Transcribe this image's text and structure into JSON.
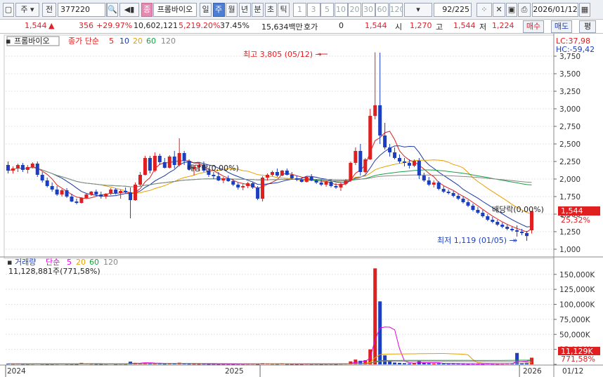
{
  "toolbar": {
    "market": "주",
    "prefix": "전",
    "code": "377220",
    "name_badge": "종",
    "name": "프롬바이오",
    "periods": [
      "일",
      "주",
      "월",
      "년",
      "분",
      "초",
      "틱"
    ],
    "active_period": "주",
    "intervals": [
      "1",
      "3",
      "5",
      "10",
      "20",
      "30",
      "60",
      "120"
    ],
    "count": "92",
    "total": "/225",
    "date": "2026/01/12"
  },
  "quote": {
    "price": "1,544",
    "change": "356",
    "change_pct": "+29.97%",
    "volume": "10,602,121",
    "volume_pct": "5,219.20%",
    "turnover_pct": "37.45%",
    "amount": "15,634백만",
    "hoga_label": "호가",
    "hoga": "0",
    "hoga_price": "1,544",
    "open_label": "시",
    "open": "1,270",
    "high_label": "고",
    "high": "1,544",
    "low_label": "저",
    "low": "1,224",
    "buy": "매수",
    "sell": "매도",
    "eval": "평"
  },
  "price_panel": {
    "legend_name": "프롬바이오",
    "legend_ma": "종가 단순",
    "ma_periods": [
      "5",
      "10",
      "20",
      "60",
      "120"
    ],
    "ma_colors": [
      "#e02020",
      "#1a3aa0",
      "#e8a000",
      "#18a040",
      "#888888"
    ],
    "lc": "LC:37,98",
    "hc": "HC:-59,42",
    "max_note": "최고 3,805 (05/12) →",
    "min_note": "최저 1,119 (01/05) →",
    "div_note1": "배당락(0,00%)",
    "div_note2": "배당락(0,00%)",
    "cur_price_tag": "1,544",
    "cur_pct_tag": "25,32%"
  },
  "volume_panel": {
    "legend_name": "거래량",
    "legend_ma": "단순",
    "ma_periods": [
      "5",
      "20",
      "60",
      "120"
    ],
    "ma_colors": [
      "#e000e0",
      "#e8a000",
      "#18a040",
      "#888888"
    ],
    "current": "11,128,881주(771,58%)",
    "cur_tag": "11,129K",
    "cur_pct_tag": "771,58%"
  },
  "x_axis": {
    "labels": [
      "2024",
      "2025",
      "2026"
    ],
    "date_label": "01/12"
  },
  "chart_data": {
    "type": "candlestick",
    "timeframe": "weekly",
    "price_axis": {
      "ticks": [
        1000,
        1250,
        1500,
        1750,
        2000,
        2250,
        2500,
        2750,
        3000,
        3250,
        3500,
        3750
      ],
      "ylim": [
        950,
        3850
      ]
    },
    "volume_axis": {
      "ticks": [
        0,
        25000,
        50000,
        75000,
        100000,
        125000,
        150000
      ],
      "tick_labels": [
        "0",
        "25,000K",
        "50,000K",
        "75,000K",
        "100,000K",
        "125,000K",
        "150,000K"
      ],
      "ylim": [
        0,
        165000
      ]
    },
    "candles": [
      [
        2200,
        2250,
        2080,
        2120
      ],
      [
        2120,
        2180,
        2080,
        2150
      ],
      [
        2150,
        2220,
        2100,
        2200
      ],
      [
        2200,
        2230,
        2100,
        2130
      ],
      [
        2130,
        2200,
        2080,
        2170
      ],
      [
        2170,
        2240,
        2150,
        2220
      ],
      [
        2220,
        2250,
        2030,
        2060
      ],
      [
        2060,
        2100,
        1950,
        1980
      ],
      [
        1980,
        2020,
        1880,
        1900
      ],
      [
        1900,
        1950,
        1820,
        1850
      ],
      [
        1850,
        1900,
        1760,
        1780
      ],
      [
        1780,
        1860,
        1750,
        1840
      ],
      [
        1840,
        1870,
        1730,
        1750
      ],
      [
        1750,
        1790,
        1670,
        1680
      ],
      [
        1680,
        1720,
        1640,
        1660
      ],
      [
        1660,
        1740,
        1650,
        1730
      ],
      [
        1730,
        1790,
        1720,
        1780
      ],
      [
        1780,
        1830,
        1760,
        1820
      ],
      [
        1820,
        1850,
        1760,
        1780
      ],
      [
        1780,
        1820,
        1720,
        1750
      ],
      [
        1750,
        1800,
        1720,
        1790
      ],
      [
        1790,
        1870,
        1770,
        1850
      ],
      [
        1850,
        1870,
        1780,
        1800
      ],
      [
        1800,
        1850,
        1720,
        1830
      ],
      [
        1830,
        1880,
        1800,
        1810
      ],
      [
        1810,
        1880,
        1440,
        1700
      ],
      [
        1700,
        1950,
        1690,
        1920
      ],
      [
        1920,
        2100,
        1900,
        2060
      ],
      [
        2060,
        2330,
        2050,
        2300
      ],
      [
        2300,
        2330,
        2080,
        2120
      ],
      [
        2120,
        2380,
        2100,
        2330
      ],
      [
        2330,
        2360,
        2200,
        2240
      ],
      [
        2240,
        2300,
        2150,
        2160
      ],
      [
        2160,
        2340,
        2150,
        2320
      ],
      [
        2320,
        2400,
        2150,
        2200
      ],
      [
        2200,
        2580,
        2180,
        2370
      ],
      [
        2370,
        2400,
        2200,
        2260
      ],
      [
        2260,
        2280,
        2120,
        2140
      ],
      [
        2140,
        2200,
        2050,
        2170
      ],
      [
        2170,
        2230,
        2120,
        2200
      ],
      [
        2200,
        2250,
        2100,
        2120
      ],
      [
        2120,
        2150,
        2030,
        2060
      ],
      [
        2060,
        2100,
        2000,
        2040
      ],
      [
        2040,
        2100,
        1970,
        1980
      ],
      [
        1980,
        2030,
        1940,
        2010
      ],
      [
        2010,
        2050,
        1960,
        1970
      ],
      [
        1970,
        2000,
        1900,
        1920
      ],
      [
        1920,
        1950,
        1850,
        1880
      ],
      [
        1880,
        1930,
        1840,
        1900
      ],
      [
        1900,
        1960,
        1870,
        1940
      ],
      [
        1940,
        1960,
        1860,
        1880
      ],
      [
        1880,
        1900,
        1700,
        1720
      ],
      [
        1720,
        2040,
        1680,
        2020
      ],
      [
        2020,
        2080,
        1980,
        2060
      ],
      [
        2060,
        2120,
        2040,
        2100
      ],
      [
        2100,
        2150,
        2030,
        2050
      ],
      [
        2050,
        2130,
        2040,
        2120
      ],
      [
        2120,
        2150,
        2050,
        2060
      ],
      [
        2060,
        2100,
        1990,
        2010
      ],
      [
        2010,
        2050,
        1970,
        1990
      ],
      [
        1990,
        2020,
        1950,
        1960
      ],
      [
        1960,
        2040,
        1950,
        2030
      ],
      [
        2030,
        2070,
        1970,
        1980
      ],
      [
        1980,
        2000,
        1930,
        1950
      ],
      [
        1950,
        1990,
        1900,
        1920
      ],
      [
        1920,
        1980,
        1890,
        1960
      ],
      [
        1960,
        2000,
        1880,
        1900
      ],
      [
        1900,
        1940,
        1860,
        1880
      ],
      [
        1880,
        1950,
        1830,
        1930
      ],
      [
        1930,
        2000,
        1910,
        1980
      ],
      [
        1980,
        2250,
        1960,
        2230
      ],
      [
        2230,
        2450,
        2200,
        2400
      ],
      [
        2400,
        2500,
        2050,
        2100
      ],
      [
        2100,
        2300,
        2080,
        2280
      ],
      [
        2280,
        3000,
        2270,
        2900
      ],
      [
        2900,
        3805,
        2850,
        3050
      ],
      [
        3050,
        3800,
        2500,
        2620
      ],
      [
        2620,
        2800,
        2420,
        2450
      ],
      [
        2450,
        2500,
        2320,
        2380
      ],
      [
        2380,
        2450,
        2280,
        2300
      ],
      [
        2300,
        2350,
        2220,
        2250
      ],
      [
        2250,
        2300,
        2180,
        2230
      ],
      [
        2230,
        2280,
        2150,
        2190
      ],
      [
        2190,
        2280,
        2170,
        2260
      ],
      [
        2260,
        2300,
        2000,
        2050
      ],
      [
        2050,
        2090,
        1960,
        1980
      ],
      [
        1980,
        2030,
        1900,
        1920
      ],
      [
        1920,
        1980,
        1880,
        1950
      ],
      [
        1950,
        1970,
        1840,
        1860
      ],
      [
        1860,
        1900,
        1800,
        1820
      ],
      [
        1820,
        1850,
        1780,
        1800
      ],
      [
        1800,
        1830,
        1740,
        1760
      ],
      [
        1760,
        1790,
        1700,
        1720
      ],
      [
        1720,
        1750,
        1650,
        1670
      ],
      [
        1670,
        1700,
        1600,
        1620
      ],
      [
        1620,
        1650,
        1540,
        1560
      ],
      [
        1560,
        1600,
        1500,
        1520
      ],
      [
        1520,
        1560,
        1450,
        1470
      ],
      [
        1470,
        1500,
        1400,
        1420
      ],
      [
        1420,
        1460,
        1370,
        1390
      ],
      [
        1390,
        1420,
        1330,
        1350
      ],
      [
        1350,
        1380,
        1300,
        1320
      ],
      [
        1320,
        1350,
        1270,
        1290
      ],
      [
        1290,
        1320,
        1250,
        1270
      ],
      [
        1270,
        1340,
        1180,
        1250
      ],
      [
        1250,
        1290,
        1200,
        1230
      ],
      [
        1230,
        1260,
        1119,
        1188
      ],
      [
        1270,
        1544,
        1224,
        1544
      ]
    ],
    "volume": [
      1200,
      900,
      1100,
      800,
      700,
      900,
      1500,
      800,
      600,
      700,
      900,
      1100,
      800,
      700,
      600,
      2500,
      1500,
      900,
      700,
      600,
      800,
      1200,
      700,
      900,
      800,
      4500,
      2500,
      1800,
      3000,
      1500,
      2200,
      1300,
      900,
      1500,
      1200,
      2800,
      1400,
      900,
      800,
      700,
      900,
      600,
      700,
      500,
      600,
      700,
      600,
      800,
      700,
      900,
      1000,
      600,
      2000,
      1500,
      900,
      800,
      1200,
      700,
      600,
      500,
      600,
      900,
      700,
      800,
      600,
      700,
      800,
      600,
      900,
      1100,
      5000,
      8000,
      6000,
      7000,
      25000,
      160000,
      105000,
      15000,
      5000,
      3000,
      2500,
      2000,
      1500,
      1800,
      6000,
      2500,
      2000,
      1500,
      1800,
      1200,
      1000,
      1500,
      1100,
      900,
      800,
      1000,
      900,
      800,
      1200,
      900,
      800,
      1000,
      1300,
      2000,
      19000,
      1500,
      3000,
      11129
    ]
  }
}
